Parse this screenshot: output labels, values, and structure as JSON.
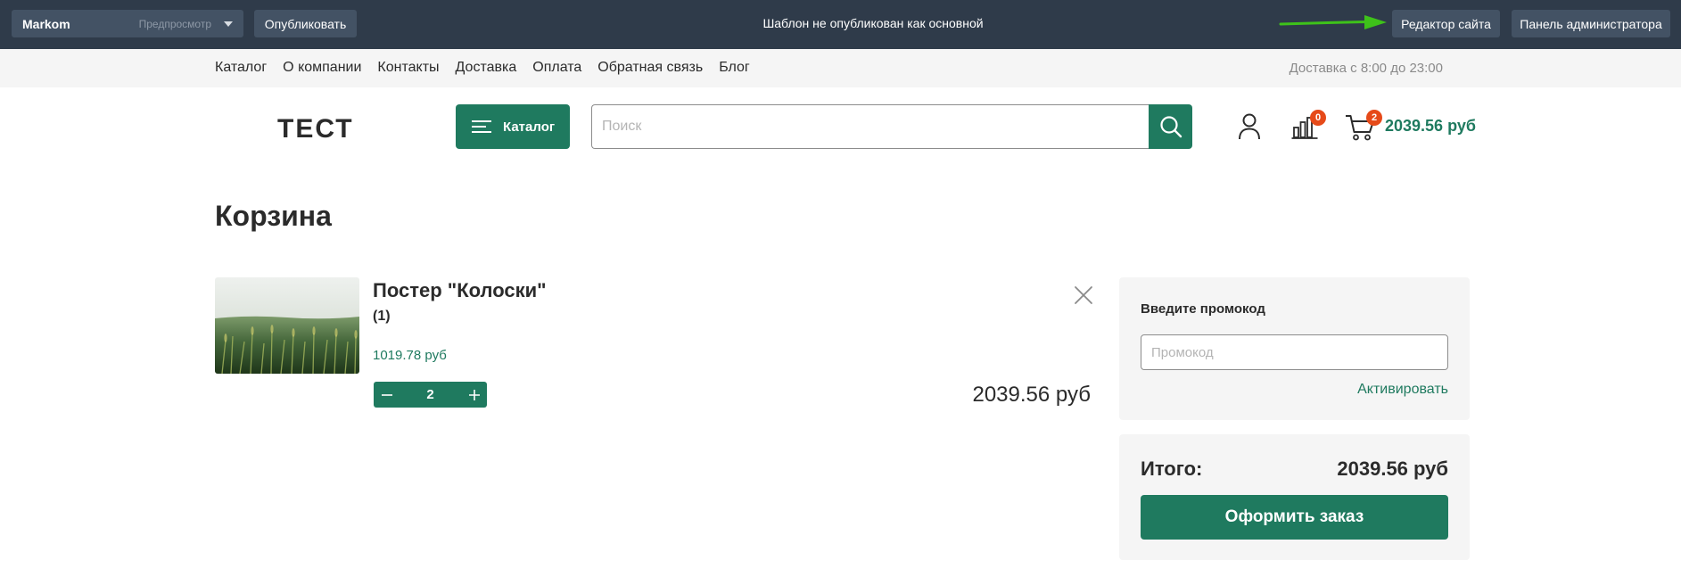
{
  "admin_bar": {
    "site_name": "Markom",
    "mode": "Предпросмотр",
    "publish_label": "Опубликовать",
    "notice": "Шаблон не опубликован как основной",
    "site_editor_label": "Редактор сайта",
    "admin_panel_label": "Панель администратора",
    "arrow_color": "#3ec21a"
  },
  "top_menu": {
    "items": [
      "Каталог",
      "О компании",
      "Контакты",
      "Доставка",
      "Оплата",
      "Обратная связь",
      "Блог"
    ],
    "delivery_hours": "Доставка с 8:00 до 23:00"
  },
  "header": {
    "logo": "ТЕСТ",
    "catalog_label": "Каталог",
    "search_placeholder": "Поиск",
    "compare_count": "0",
    "cart_count": "2",
    "cart_total": "2039.56 руб"
  },
  "page": {
    "title": "Корзина"
  },
  "cart_item": {
    "name": "Постер \"Колоски\"",
    "variant": "(1)",
    "unit_price": "1019.78 руб",
    "quantity": "2",
    "line_total": "2039.56 руб"
  },
  "promo": {
    "label": "Введите промокод",
    "placeholder": "Промокод",
    "activate_label": "Активировать"
  },
  "summary": {
    "total_label": "Итого:",
    "total_value": "2039.56 руб",
    "checkout_label": "Оформить заказ"
  },
  "colors": {
    "accent": "#1f7a5f",
    "admin_bar": "#2f3b4a",
    "badge": "#e64a19"
  }
}
